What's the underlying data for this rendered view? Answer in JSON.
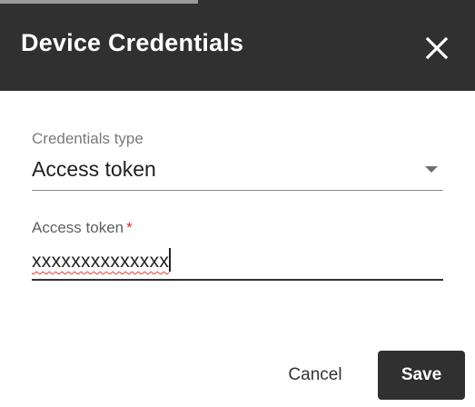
{
  "dialog": {
    "title": "Device Credentials",
    "close_icon": "close-icon"
  },
  "form": {
    "credentials_type": {
      "label": "Credentials type",
      "selected_value": "Access token",
      "dropdown_icon": "chevron-down-icon"
    },
    "access_token": {
      "label": "Access token",
      "required_marker": "*",
      "value": "xxxxxxxxxxxxxx"
    }
  },
  "actions": {
    "cancel_label": "Cancel",
    "save_label": "Save"
  },
  "colors": {
    "header_bg": "#303030",
    "primary_button_bg": "#303030",
    "required_star": "#d32f2f",
    "spellcheck_underline": "#e53935"
  }
}
